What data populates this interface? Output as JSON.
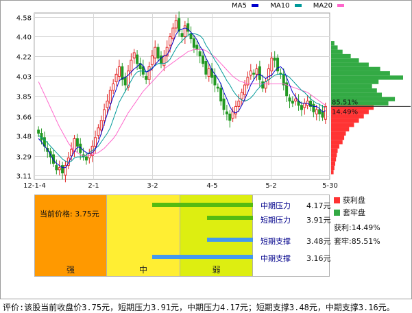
{
  "legend": {
    "ma": [
      {
        "label": "MA5",
        "color": "#0000cc"
      },
      {
        "label": "MA10",
        "color": "#009999"
      },
      {
        "label": "MA20",
        "color": "#ff66cc"
      }
    ],
    "profit_label": "获利盘",
    "profit_color": "#ff3333",
    "locked_label": "套牢盘",
    "locked_color": "#33aa44",
    "profit_pct": "获利:14.49%",
    "locked_pct": "套牢:85.51%"
  },
  "chart_data": {
    "type": "candlestick",
    "y_ticks": [
      "4.58",
      "4.40",
      "4.22",
      "4.03",
      "3.85",
      "3.66",
      "3.48",
      "3.29",
      "3.11"
    ],
    "x_ticks": [
      "12-1-4",
      "2-1",
      "3-2",
      "4-5",
      "5-2",
      "5-30"
    ],
    "ylim": [
      3.07,
      4.62
    ],
    "series_close": [
      3.5,
      3.44,
      3.38,
      3.33,
      3.28,
      3.22,
      3.16,
      3.18,
      3.13,
      3.2,
      3.27,
      3.35,
      3.45,
      3.38,
      3.32,
      3.28,
      3.25,
      3.31,
      3.38,
      3.46,
      3.55,
      3.62,
      3.72,
      3.8,
      3.9,
      3.96,
      4.05,
      4.12,
      4.0,
      3.95,
      4.08,
      4.18,
      4.25,
      4.15,
      4.1,
      4.05,
      4.0,
      4.12,
      4.22,
      4.3,
      4.2,
      4.15,
      4.22,
      4.3,
      4.4,
      4.48,
      4.55,
      4.45,
      4.4,
      4.5,
      4.45,
      4.38,
      4.3,
      4.28,
      4.22,
      4.15,
      4.05,
      4.1,
      4.02,
      3.95,
      3.92,
      3.8,
      3.72,
      3.68,
      3.62,
      3.7,
      3.75,
      3.8,
      3.88,
      3.95,
      4.02,
      4.08,
      4.05,
      4.1,
      4.0,
      3.92,
      3.98,
      4.1,
      4.2,
      4.18,
      4.08,
      4.05,
      3.95,
      3.85,
      3.8,
      3.78,
      3.82,
      3.76,
      3.72,
      3.78,
      3.8,
      3.75,
      3.7,
      3.72,
      3.68,
      3.65,
      3.75
    ],
    "ma5": [
      3.45,
      3.42,
      3.38,
      3.35,
      3.3,
      3.25,
      3.22,
      3.2,
      3.18,
      3.18,
      3.22,
      3.28,
      3.33,
      3.37,
      3.37,
      3.34,
      3.32,
      3.31,
      3.32,
      3.35,
      3.42,
      3.5,
      3.59,
      3.68,
      3.76,
      3.84,
      3.91,
      3.99,
      4.01,
      4.02,
      4.04,
      4.07,
      4.1,
      4.12,
      4.15,
      4.13,
      4.07,
      4.08,
      4.1,
      4.14,
      4.17,
      4.2,
      4.22,
      4.23,
      4.28,
      4.35,
      4.42,
      4.46,
      4.47,
      4.48,
      4.47,
      4.44,
      4.41,
      4.37,
      4.31,
      4.27,
      4.2,
      4.15,
      4.09,
      4.05,
      4.01,
      3.96,
      3.88,
      3.82,
      3.75,
      3.7,
      3.69,
      3.71,
      3.76,
      3.82,
      3.88,
      3.95,
      4.0,
      4.04,
      4.05,
      4.03,
      4.01,
      4.03,
      4.04,
      4.08,
      4.11,
      4.12,
      4.09,
      4.02,
      3.95,
      3.88,
      3.84,
      3.8,
      3.78,
      3.78,
      3.78,
      3.76,
      3.75,
      3.75,
      3.73,
      3.7,
      3.71
    ],
    "ma10": [
      3.48,
      3.46,
      3.44,
      3.41,
      3.38,
      3.35,
      3.32,
      3.29,
      3.26,
      3.24,
      3.23,
      3.24,
      3.27,
      3.28,
      3.28,
      3.28,
      3.3,
      3.32,
      3.34,
      3.36,
      3.38,
      3.42,
      3.46,
      3.5,
      3.55,
      3.63,
      3.71,
      3.79,
      3.84,
      3.89,
      3.94,
      3.99,
      4.04,
      4.07,
      4.08,
      4.08,
      4.07,
      4.09,
      4.11,
      4.13,
      4.15,
      4.15,
      4.15,
      4.16,
      4.19,
      4.24,
      4.29,
      4.33,
      4.36,
      4.39,
      4.41,
      4.43,
      4.43,
      4.42,
      4.41,
      4.38,
      4.32,
      4.28,
      4.23,
      4.18,
      4.14,
      4.09,
      4.04,
      3.99,
      3.95,
      3.9,
      3.86,
      3.83,
      3.81,
      3.8,
      3.81,
      3.83,
      3.86,
      3.9,
      3.93,
      3.96,
      3.98,
      4.0,
      4.02,
      4.04,
      4.05,
      4.05,
      4.05,
      4.04,
      4.02,
      3.99,
      3.96,
      3.93,
      3.9,
      3.88,
      3.85,
      3.82,
      3.8,
      3.78,
      3.77,
      3.75,
      3.74
    ],
    "ma20": [
      3.98,
      3.92,
      3.86,
      3.8,
      3.74,
      3.68,
      3.62,
      3.56,
      3.51,
      3.46,
      3.41,
      3.37,
      3.34,
      3.32,
      3.3,
      3.29,
      3.29,
      3.29,
      3.3,
      3.31,
      3.32,
      3.34,
      3.36,
      3.39,
      3.42,
      3.45,
      3.49,
      3.54,
      3.59,
      3.64,
      3.69,
      3.73,
      3.77,
      3.81,
      3.85,
      3.89,
      3.92,
      3.95,
      3.98,
      4.01,
      4.04,
      4.07,
      4.1,
      4.12,
      4.14,
      4.16,
      4.18,
      4.2,
      4.22,
      4.24,
      4.26,
      4.27,
      4.28,
      4.28,
      4.28,
      4.28,
      4.27,
      4.25,
      4.23,
      4.21,
      4.18,
      4.15,
      4.12,
      4.09,
      4.06,
      4.03,
      4.01,
      3.99,
      3.98,
      3.97,
      3.96,
      3.96,
      3.96,
      3.96,
      3.96,
      3.96,
      3.96,
      3.96,
      3.96,
      3.96,
      3.96,
      3.96,
      3.96,
      3.95,
      3.94,
      3.93,
      3.92,
      3.91,
      3.9,
      3.89,
      3.88,
      3.86,
      3.84,
      3.82,
      3.8,
      3.78,
      3.76
    ],
    "chip_profile": {
      "prices": [
        3.14,
        3.18,
        3.22,
        3.26,
        3.3,
        3.34,
        3.38,
        3.42,
        3.46,
        3.5,
        3.54,
        3.58,
        3.62,
        3.66,
        3.7,
        3.74,
        3.78,
        3.82,
        3.86,
        3.9,
        3.94,
        3.98,
        4.02,
        4.06,
        4.1,
        4.14,
        4.18,
        4.22,
        4.26,
        4.3,
        4.34
      ],
      "values": [
        3,
        4,
        5,
        6,
        7,
        8,
        10,
        14,
        16,
        18,
        22,
        28,
        34,
        40,
        46,
        52,
        70,
        78,
        62,
        56,
        50,
        58,
        88,
        72,
        60,
        46,
        34,
        24,
        14,
        8,
        4
      ],
      "current_price": 3.75
    },
    "profit_ratio": "85.51%",
    "loss_ratio": "14.49%"
  },
  "pressure": {
    "current_price_text": "当前价格: 3.75元",
    "zones": [
      "强",
      "中",
      "弱"
    ],
    "levels": [
      {
        "label": "中期压力",
        "value": "4.17元",
        "color": "#55bb11",
        "start": 0.54,
        "end": 1.0
      },
      {
        "label": "短期压力",
        "value": "3.91元",
        "color": "#55bb11",
        "start": 0.79,
        "end": 1.0
      },
      {
        "label": "短期支撑",
        "value": "3.48元",
        "color": "#4499ee",
        "start": 0.79,
        "end": 1.0
      },
      {
        "label": "中期支撑",
        "value": "3.16元",
        "color": "#4499ee",
        "start": 0.54,
        "end": 1.0
      }
    ]
  },
  "summary": "评价:该股当前收盘价3.75元，短期压力3.91元，中期压力4.17元；短期支撑3.48元，中期支撑3.16元。"
}
